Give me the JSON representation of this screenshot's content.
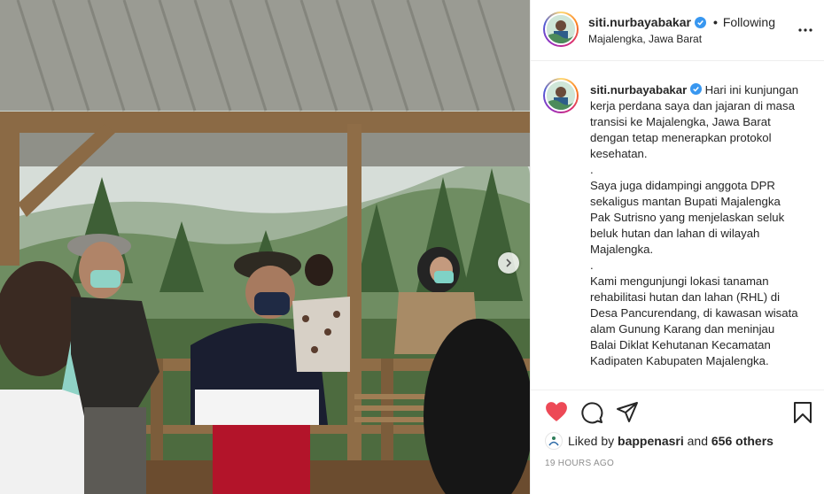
{
  "post": {
    "username": "siti.nurbayabakar",
    "follow_status": "Following",
    "dot": "•",
    "location": "Majalengka, Jawa Barat",
    "verified": true,
    "caption": "Hari ini kunjungan kerja perdana saya dan jajaran di masa transisi ke Majalengka, Jawa Barat dengan tetap menerapkan protokol kesehatan.\n.\nSaya juga didampingi anggota DPR sekaligus mantan Bupati Majalengka Pak Sutrisno yang menjelaskan seluk beluk hutan dan lahan di wilayah Majalengka.\n.\nKami mengunjungi lokasi tanaman rehabilitasi hutan dan lahan (RHL) di Desa Pancurendang, di kawasan wisata alam Gunung Karang dan meninjau Balai Diklat Kehutanan Kecamatan Kadipaten Kabupaten Majalengka.",
    "likes": {
      "prefix": "Liked by",
      "liked_by_user": "bappenasri",
      "and": "and",
      "others": "656 others"
    },
    "timestamp": "19 HOURS AGO"
  },
  "icons": {
    "like": "heart-filled-icon",
    "comment": "comment-icon",
    "share": "share-icon",
    "save": "bookmark-icon",
    "more": "more-options-icon",
    "next": "chevron-right-icon",
    "verified": "verified-badge-icon"
  },
  "colors": {
    "like_red": "#ed4956",
    "verified_blue": "#3897f0",
    "muted_text": "#8e8e8e",
    "border": "#efefef"
  }
}
